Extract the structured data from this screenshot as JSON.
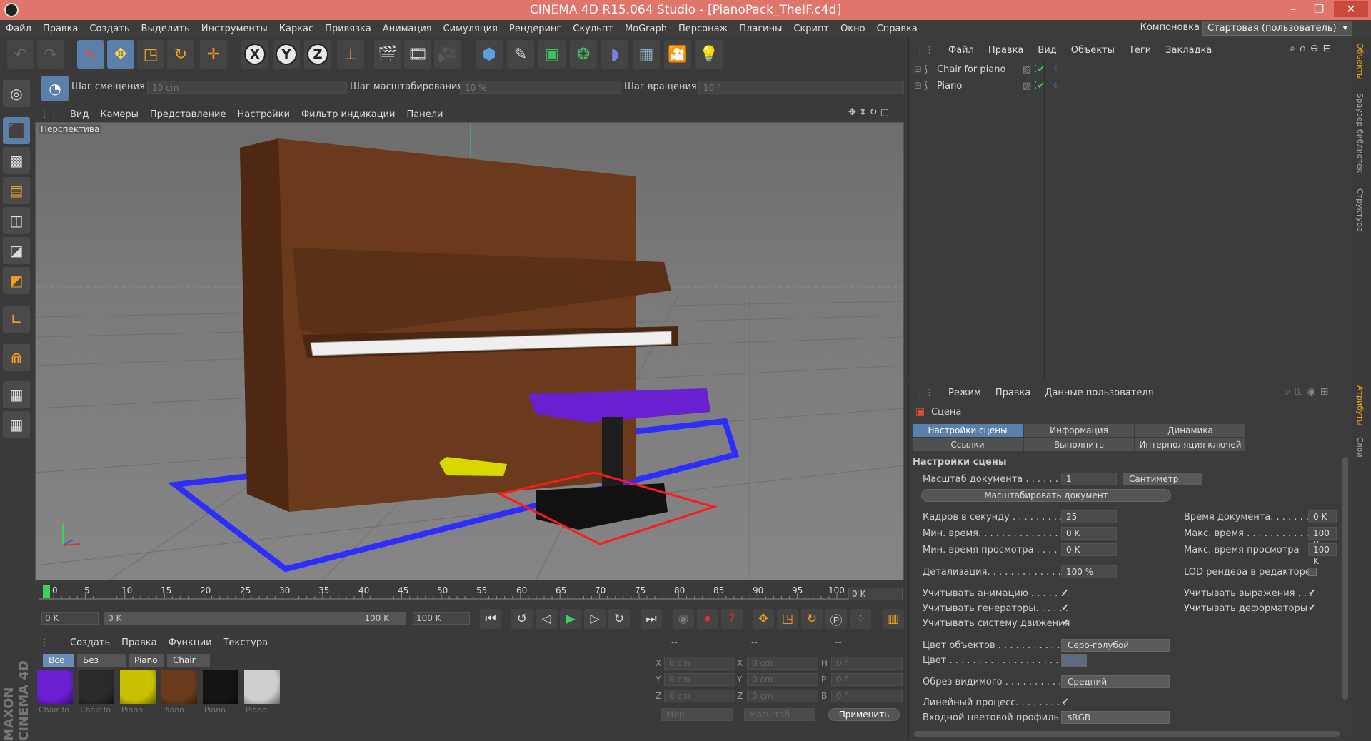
{
  "window": {
    "title": "CINEMA 4D R15.064 Studio - [PianoPack_TheIF.c4d]",
    "minimize": "–",
    "restore": "❐",
    "close": "✕"
  },
  "menu": [
    "Файл",
    "Правка",
    "Создать",
    "Выделить",
    "Инструменты",
    "Каркас",
    "Привязка",
    "Анимация",
    "Симуляция",
    "Рендеринг",
    "Скульпт",
    "MoGraph",
    "Персонаж",
    "Плагины",
    "Скрипт",
    "Окно",
    "Справка"
  ],
  "layout": {
    "label": "Компоновка",
    "value": "Стартовая (пользователь)"
  },
  "steps": {
    "move_label": "Шаг смещения",
    "move_value": "10 cm",
    "scale_label": "Шаг масштабирования",
    "scale_value": "10 %",
    "rotate_label": "Шаг вращения",
    "rotate_value": "10 °"
  },
  "viewport": {
    "menu": [
      "Вид",
      "Камеры",
      "Представление",
      "Настройки",
      "Фильтр индикации",
      "Панели"
    ],
    "label": "Перспектива"
  },
  "timeline": {
    "ticks": [
      "0",
      "5",
      "10",
      "15",
      "20",
      "25",
      "30",
      "35",
      "40",
      "45",
      "50",
      "55",
      "60",
      "65",
      "70",
      "75",
      "80",
      "85",
      "90",
      "95",
      "100"
    ],
    "current": "0 K",
    "start": "0 K",
    "range_start": "0 K",
    "range_end": "100 K",
    "end": "100 K"
  },
  "materials": {
    "menu": [
      "Создать",
      "Правка",
      "Функции",
      "Текстура"
    ],
    "tabs": [
      "Все",
      "Без слоя",
      "Piano",
      "Chair"
    ],
    "items": [
      {
        "label": "Chair fo",
        "color": "#6a1fd0"
      },
      {
        "label": "Chair fo",
        "color": "#2a2a2a"
      },
      {
        "label": "Piano",
        "color": "#c8c000"
      },
      {
        "label": "Piano",
        "color": "#6b3a1c"
      },
      {
        "label": "Piano",
        "color": "#141414"
      },
      {
        "label": "Piano",
        "color": "#cfcfcf"
      }
    ]
  },
  "coords": {
    "header1": "--",
    "header2": "--",
    "header3": "--",
    "x": "0 cm",
    "y": "0 cm",
    "z": "0 cm",
    "sx": "0 cm",
    "sy": "0 cm",
    "sz": "0 cm",
    "h": "0 °",
    "p": "0 °",
    "b": "0 °",
    "world": "Мир",
    "scale": "Масштаб",
    "apply": "Применить"
  },
  "objects": {
    "menu": [
      "Файл",
      "Правка",
      "Вид",
      "Объекты",
      "Теги",
      "Закладка"
    ],
    "items": [
      "Chair for piano",
      "Piano"
    ]
  },
  "attributes": {
    "menu": [
      "Режим",
      "Правка",
      "Данные пользователя"
    ],
    "header": "Сцена",
    "tabs": [
      "Настройки сцены",
      "Информация",
      "Динамика",
      "Ссылки",
      "Выполнить",
      "Интерполяция ключей"
    ],
    "section": "Настройки сцены",
    "doc_scale_label": "Масштаб документа . . . . . . . .",
    "doc_scale_value": "1",
    "doc_scale_unit": "Сантиметр",
    "scale_doc_btn": "Масштабировать документ",
    "fps_label": "Кадров в секунду . . . . . . . . . .",
    "fps_value": "25",
    "doc_time_label": "Время документа. . . . . . . .",
    "doc_time_value": "0 K",
    "min_time_label": "Мин. время. . . . . . . . . . . . . . .",
    "min_time_value": "0 K",
    "max_time_label": "Макс. время . . . . . . . . . . . .",
    "max_time_value": "100 K",
    "min_preview_label": "Мин. время просмотра . . . . . .",
    "min_preview_value": "0 K",
    "max_preview_label": "Макс. время просмотра",
    "max_preview_value": "100 K",
    "lod_label": "Детализация. . . . . . . . . . . . . . .",
    "lod_value": "100 %",
    "lod_render_label": "LOD рендера в редакторе",
    "use_anim_label": "Учитывать анимацию . . . . . . .",
    "use_expr_label": "Учитывать выражения . . .",
    "use_gen_label": "Учитывать генераторы. . . . . .",
    "use_deform_label": "Учитывать деформаторы",
    "use_motion_label": "Учитывать систему движения",
    "obj_color_label": "Цвет объектов . . . . . . . . . . . .",
    "obj_color_value": "Серо-голубой",
    "color_label": "Цвет . . . . . . . . . . . . . . . . . . . .",
    "clip_label": "Обрез видимого . . . . . . . . . . .",
    "clip_value": "Средний",
    "linear_label": "Линейный процесс. . . . . . . . .",
    "profile_label": "Входной цветовой профиль",
    "profile_value": "sRGB",
    "check": "✔"
  },
  "side_tabs": [
    "Объекты",
    "Браузер библиотек",
    "Структура",
    "Атрибуты",
    "Слои"
  ],
  "brand": "MAXON CINEMA 4D"
}
